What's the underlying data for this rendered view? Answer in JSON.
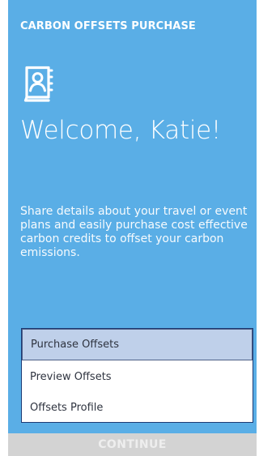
{
  "app": {
    "title": "CARBON OFFSETS PURCHASE"
  },
  "welcome": {
    "heading": "Welcome, Katie!",
    "description": "Share details about your travel or event plans and easily purchase cost effective carbon credits to offset your carbon emissions."
  },
  "menu": {
    "items": [
      {
        "label": "Purchase Offsets",
        "selected": true
      },
      {
        "label": "Preview Offsets",
        "selected": false
      },
      {
        "label": "Offsets Profile",
        "selected": false
      }
    ]
  },
  "actions": {
    "continue_label": "CONTINUE"
  },
  "icons": {
    "profile": "address-book-icon"
  },
  "colors": {
    "accent": "#5aaee6",
    "selected": "#bfd0ea",
    "disabled_bg": "#d3d3d3",
    "disabled_text": "#eeeeee"
  }
}
